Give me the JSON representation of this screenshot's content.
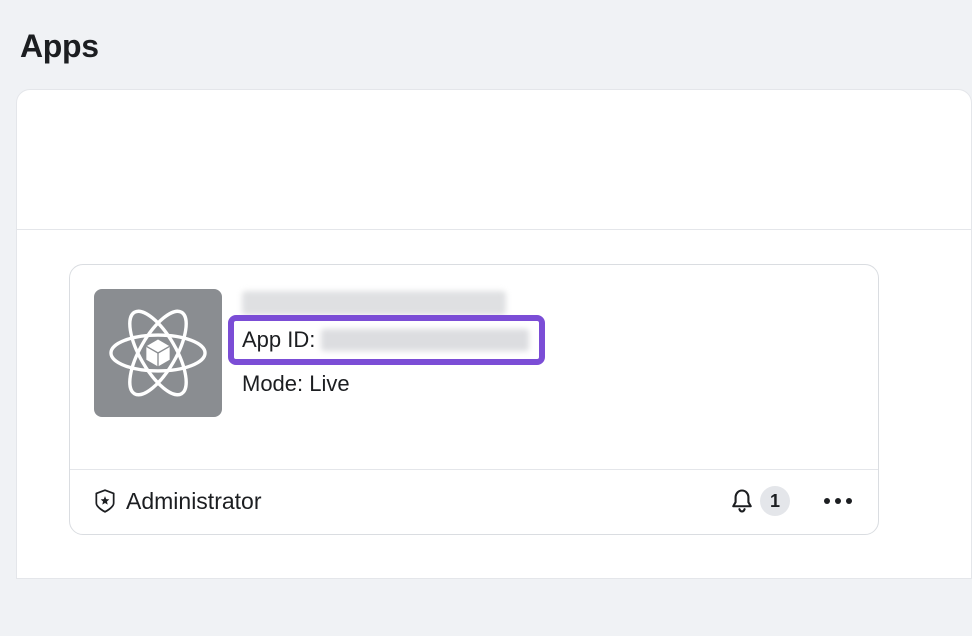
{
  "page": {
    "title": "Apps"
  },
  "app": {
    "app_id_prefix": "App ID:",
    "mode_line": "Mode: Live",
    "role": "Administrator",
    "notification_count": "1"
  }
}
